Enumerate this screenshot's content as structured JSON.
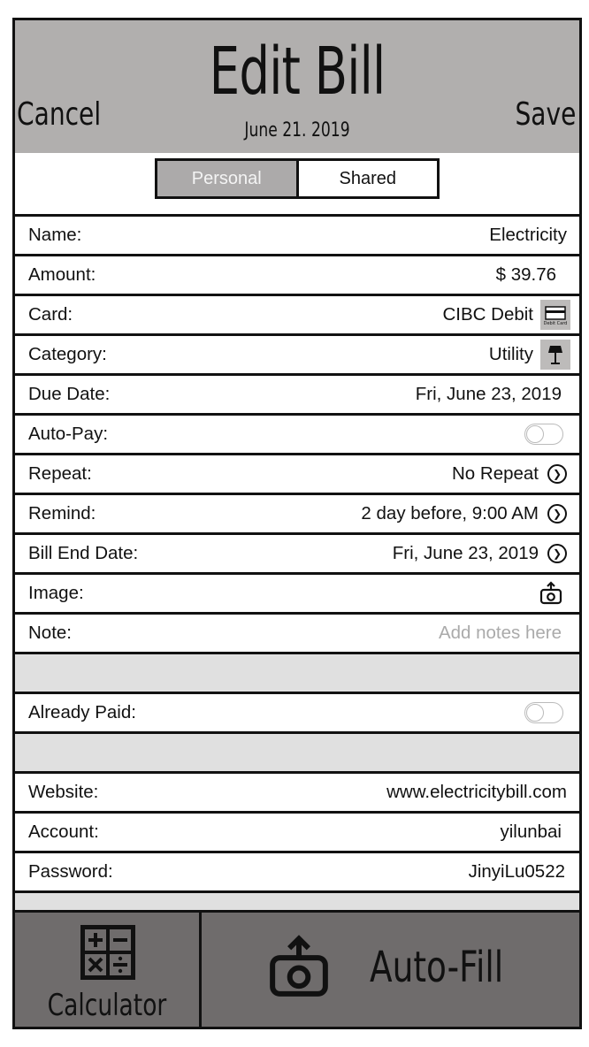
{
  "header": {
    "title": "Edit Bill",
    "date": "June 21. 2019",
    "cancel_label": "Cancel",
    "save_label": "Save"
  },
  "segmented": {
    "options": [
      "Personal",
      "Shared"
    ],
    "selected": "Personal"
  },
  "fields": {
    "name": {
      "label": "Name:",
      "value": "Electricity"
    },
    "amount": {
      "label": "Amount:",
      "value": "$ 39.76"
    },
    "card": {
      "label": "Card:",
      "value": "CIBC Debit",
      "icon": "debit-card-icon",
      "icon_text": "Debit Card"
    },
    "category": {
      "label": "Category:",
      "value": "Utility",
      "icon": "lamp-icon"
    },
    "due_date": {
      "label": "Due Date:",
      "value": "Fri, June 23, 2019"
    },
    "auto_pay": {
      "label": "Auto-Pay:",
      "on": false
    },
    "repeat": {
      "label": "Repeat:",
      "value": "No Repeat"
    },
    "remind": {
      "label": "Remind:",
      "value": "2 day before, 9:00 AM"
    },
    "bill_end_date": {
      "label": "Bill End Date:",
      "value": "Fri, June 23, 2019"
    },
    "image": {
      "label": "Image:",
      "icon": "camera-upload-icon"
    },
    "note": {
      "label": "Note:",
      "placeholder": "Add notes here"
    },
    "already_paid": {
      "label": "Already Paid:",
      "on": false
    },
    "website": {
      "label": "Website:",
      "value": "www.electricitybill.com"
    },
    "account": {
      "label": "Account:",
      "value": "yilunbai"
    },
    "password": {
      "label": "Password:",
      "value": "JinyiLu0522"
    }
  },
  "bottom_bar": {
    "calculator_label": "Calculator",
    "autofill_label": "Auto-Fill"
  },
  "colors": {
    "header_bg": "#b1afae",
    "bottom_bg": "#6f6c6c",
    "spacer_bg": "#e0e0e0",
    "selected_segment": "#acaaaa"
  }
}
